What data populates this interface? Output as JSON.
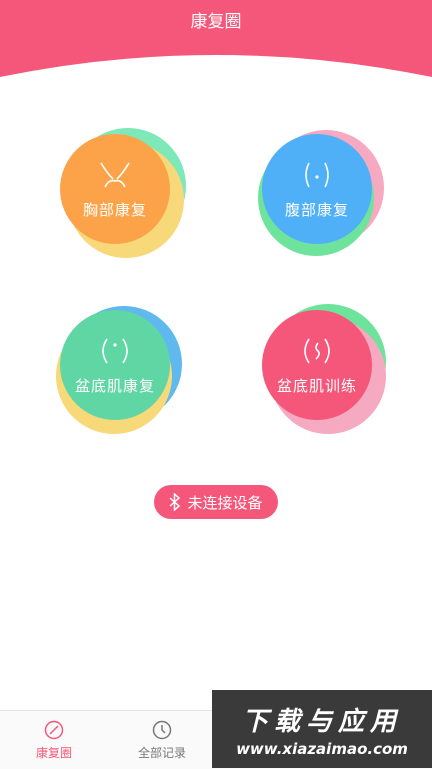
{
  "header": {
    "title": "康复圈"
  },
  "modules": [
    {
      "label": "胸部康复",
      "icon": "chest-icon",
      "color": "#fca34a",
      "ring1": "#7ee8b8",
      "ring2": "#f7d979"
    },
    {
      "label": "腹部康复",
      "icon": "abdomen-icon",
      "color": "#4fb0f8",
      "ring1": "#f6aac1",
      "ring2": "#6ee39b"
    },
    {
      "label": "盆底肌康复",
      "icon": "pelvic-icon",
      "color": "#5fd6a4",
      "ring1": "#5fb9ef",
      "ring2": "#f7d979"
    },
    {
      "label": "盆底肌训练",
      "icon": "pelvic-training-icon",
      "color": "#f5577a",
      "ring1": "#6ee39b",
      "ring2": "#f6aac1"
    }
  ],
  "device": {
    "status_label": "未连接设备",
    "icon": "bluetooth-icon"
  },
  "tabs": [
    {
      "label": "康复圈",
      "icon": "compass-icon",
      "active": true
    },
    {
      "label": "全部记录",
      "icon": "clock-icon",
      "active": false
    }
  ],
  "watermark": {
    "title": "下载与应用",
    "url": "www.xiazaimao.com"
  },
  "colors": {
    "accent": "#f5577a"
  }
}
